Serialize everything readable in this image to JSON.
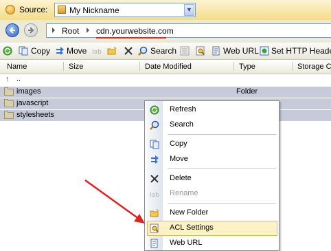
{
  "source": {
    "label": "Source:",
    "selected": "My Nickname"
  },
  "address": {
    "crumbs": [
      "Root",
      "cdn.yourwebsite.com"
    ]
  },
  "toolbar": {
    "copy": "Copy",
    "move": "Move",
    "search": "Search",
    "web_url": "Web URL",
    "set_http_headers": "Set HTTP Headers"
  },
  "columns": [
    "Name",
    "Size",
    "Date Modified",
    "Type",
    "Storage C"
  ],
  "files": {
    "up": "..",
    "rows": [
      {
        "name": "images",
        "type": "Folder"
      },
      {
        "name": "javascript",
        "type": ""
      },
      {
        "name": "stylesheets",
        "type": ""
      }
    ]
  },
  "context_menu": {
    "items": [
      "Refresh",
      "Search",
      "Copy",
      "Move",
      "Delete",
      "Rename",
      "New Folder",
      "ACL Settings",
      "Web URL"
    ],
    "disabled": [
      "Rename"
    ],
    "highlighted": "ACL Settings"
  },
  "colors": {
    "selection": "#c6cad9",
    "highlight_bg": "#fcf2c6",
    "annotation": "#e22222"
  }
}
